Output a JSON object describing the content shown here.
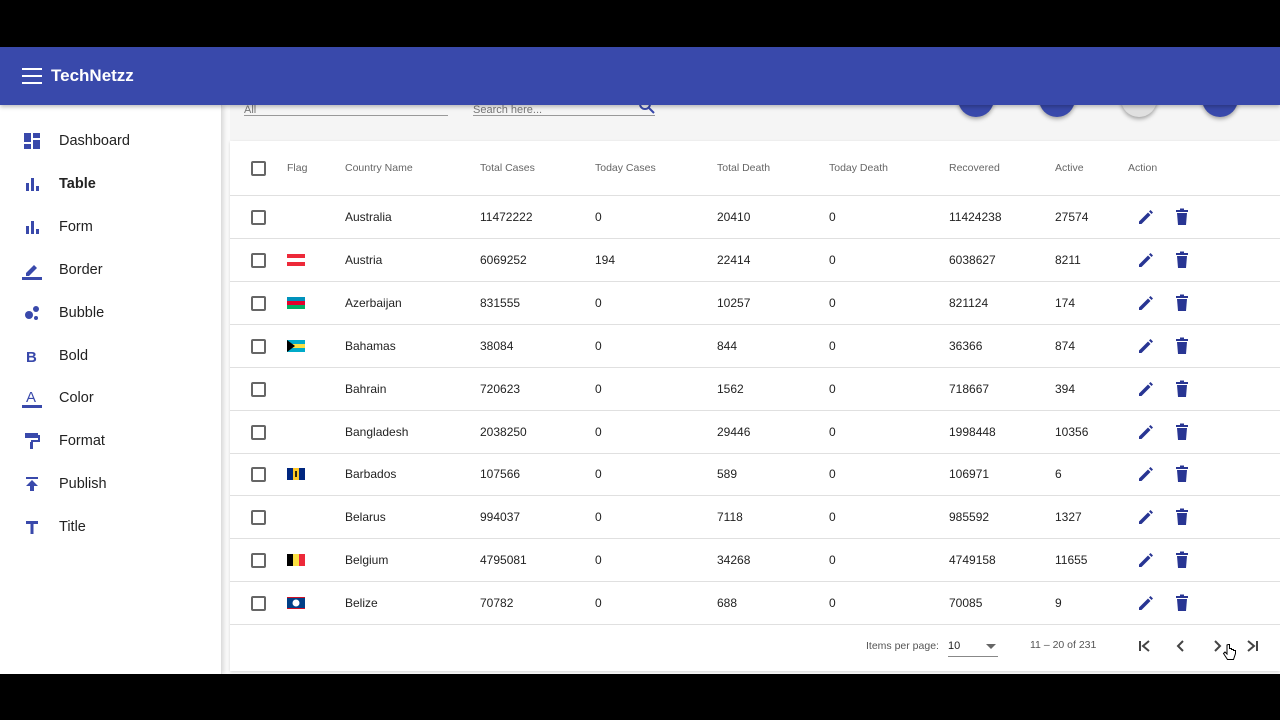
{
  "app": {
    "title": "TechNetzz"
  },
  "sidebar": {
    "items": [
      {
        "label": "Dashboard",
        "icon": "dashboard-icon"
      },
      {
        "label": "Table",
        "icon": "bar-chart-icon",
        "active": true
      },
      {
        "label": "Form",
        "icon": "bar-chart-icon"
      },
      {
        "label": "Border",
        "icon": "border-color-icon"
      },
      {
        "label": "Bubble",
        "icon": "bubble-chart-icon"
      },
      {
        "label": "Bold",
        "icon": "format-bold-icon"
      },
      {
        "label": "Color",
        "icon": "text-color-icon"
      },
      {
        "label": "Format",
        "icon": "format-paint-icon"
      },
      {
        "label": "Publish",
        "icon": "publish-icon"
      },
      {
        "label": "Title",
        "icon": "title-icon"
      }
    ]
  },
  "filters": {
    "select_value": "All",
    "search_placeholder": "Search here..."
  },
  "table": {
    "headers": [
      "Flag",
      "Country Name",
      "Total Cases",
      "Today Cases",
      "Total Death",
      "Today Death",
      "Recovered",
      "Active",
      "Action"
    ],
    "rows": [
      {
        "flag": "",
        "country": "Australia",
        "total_cases": "11472222",
        "today_cases": "0",
        "total_death": "20410",
        "today_death": "0",
        "recovered": "11424238",
        "active": "27574"
      },
      {
        "flag": "austria",
        "country": "Austria",
        "total_cases": "6069252",
        "today_cases": "194",
        "total_death": "22414",
        "today_death": "0",
        "recovered": "6038627",
        "active": "8211"
      },
      {
        "flag": "azerbaijan",
        "country": "Azerbaijan",
        "total_cases": "831555",
        "today_cases": "0",
        "total_death": "10257",
        "today_death": "0",
        "recovered": "821124",
        "active": "174"
      },
      {
        "flag": "bahamas",
        "country": "Bahamas",
        "total_cases": "38084",
        "today_cases": "0",
        "total_death": "844",
        "today_death": "0",
        "recovered": "36366",
        "active": "874"
      },
      {
        "flag": "",
        "country": "Bahrain",
        "total_cases": "720623",
        "today_cases": "0",
        "total_death": "1562",
        "today_death": "0",
        "recovered": "718667",
        "active": "394"
      },
      {
        "flag": "",
        "country": "Bangladesh",
        "total_cases": "2038250",
        "today_cases": "0",
        "total_death": "29446",
        "today_death": "0",
        "recovered": "1998448",
        "active": "10356"
      },
      {
        "flag": "barbados",
        "country": "Barbados",
        "total_cases": "107566",
        "today_cases": "0",
        "total_death": "589",
        "today_death": "0",
        "recovered": "106971",
        "active": "6"
      },
      {
        "flag": "",
        "country": "Belarus",
        "total_cases": "994037",
        "today_cases": "0",
        "total_death": "7118",
        "today_death": "0",
        "recovered": "985592",
        "active": "1327"
      },
      {
        "flag": "belgium",
        "country": "Belgium",
        "total_cases": "4795081",
        "today_cases": "0",
        "total_death": "34268",
        "today_death": "0",
        "recovered": "4749158",
        "active": "11655"
      },
      {
        "flag": "belize",
        "country": "Belize",
        "total_cases": "70782",
        "today_cases": "0",
        "total_death": "688",
        "today_death": "0",
        "recovered": "70085",
        "active": "9"
      }
    ]
  },
  "paginator": {
    "items_per_page_label": "Items per page:",
    "page_size": "10",
    "range_label": "11 – 20 of 231"
  },
  "colors": {
    "primary": "#3949ab",
    "action": "#283593"
  }
}
